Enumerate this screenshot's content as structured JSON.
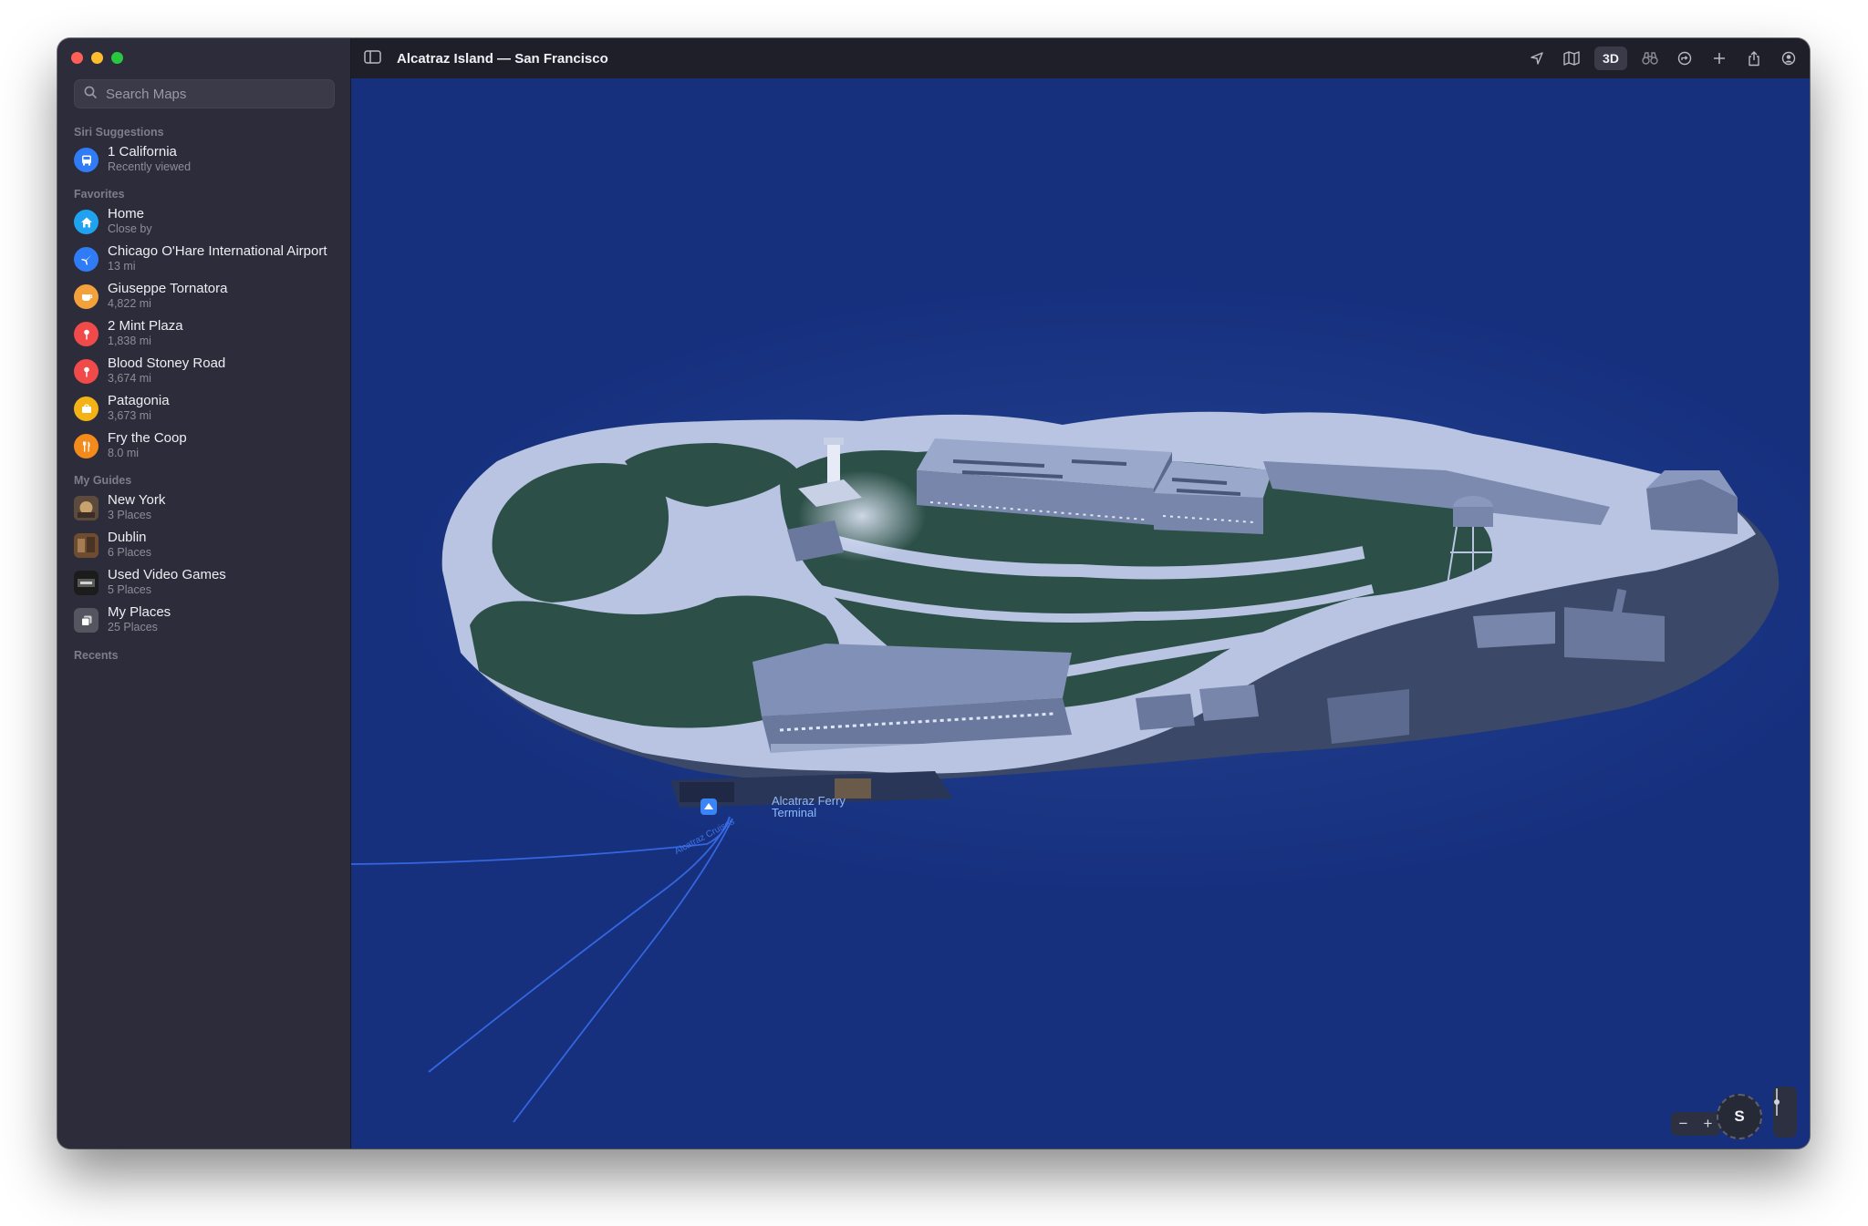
{
  "window": {
    "title": "Alcatraz Island — San Francisco"
  },
  "search": {
    "placeholder": "Search Maps"
  },
  "sections": {
    "siri": "Siri Suggestions",
    "favorites": "Favorites",
    "guides": "My Guides",
    "recents": "Recents"
  },
  "siri_items": [
    {
      "title": "1 California",
      "subtitle": "Recently viewed",
      "icon": "bus-icon",
      "color": "#2f7cf6"
    }
  ],
  "favorites": [
    {
      "title": "Home",
      "subtitle": "Close by",
      "icon": "home-icon",
      "color": "#1fa3f0"
    },
    {
      "title": "Chicago O'Hare International Airport",
      "subtitle": "13 mi",
      "icon": "airplane-icon",
      "color": "#2f7cf6"
    },
    {
      "title": "Giuseppe Tornatora",
      "subtitle": "4,822 mi",
      "icon": "cup-icon",
      "color": "#f3a13b"
    },
    {
      "title": "2 Mint Plaza",
      "subtitle": "1,838 mi",
      "icon": "pin-icon",
      "color": "#f04a4a"
    },
    {
      "title": "Blood Stoney Road",
      "subtitle": "3,674 mi",
      "icon": "pin-icon",
      "color": "#f04a4a"
    },
    {
      "title": "Patagonia",
      "subtitle": "3,673 mi",
      "icon": "shopping-icon",
      "color": "#f3b316"
    },
    {
      "title": "Fry the Coop",
      "subtitle": "8.0 mi",
      "icon": "fork-knife-icon",
      "color": "#f38a1c"
    }
  ],
  "guides": [
    {
      "title": "New York",
      "subtitle": "3 Places",
      "icon": "guide-thumb-icon",
      "color": "#6a5a4a"
    },
    {
      "title": "Dublin",
      "subtitle": "6 Places",
      "icon": "guide-thumb-icon",
      "color": "#7a5a3a"
    },
    {
      "title": "Used Video Games",
      "subtitle": "5 Places",
      "icon": "guide-thumb-icon",
      "color": "#3a3a3a"
    },
    {
      "title": "My Places",
      "subtitle": "25 Places",
      "icon": "collection-icon",
      "color": "#8a8a95"
    }
  ],
  "toolbar": {
    "btn_3d": "3D"
  },
  "map": {
    "ferry_label_1": "Alcatraz Ferry",
    "ferry_label_2": "Terminal",
    "route_label": "Alcatraz Cruises",
    "compass": "S"
  },
  "colors": {
    "water": "#16307e",
    "land": "#b8c4e2",
    "grass": "#2c5048",
    "building": "#8090b6"
  }
}
